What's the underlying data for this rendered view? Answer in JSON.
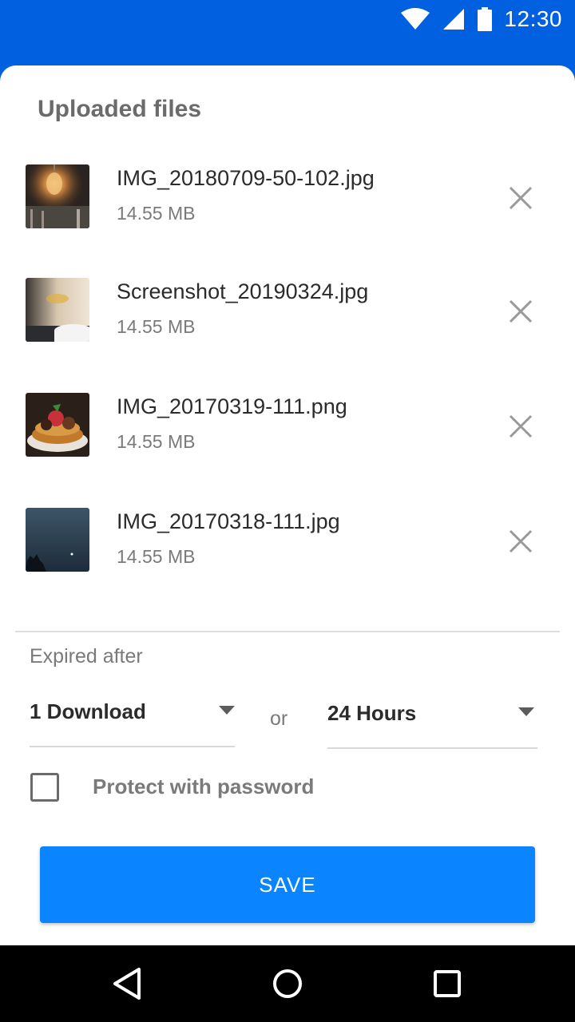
{
  "status_bar": {
    "time": "12:30",
    "icons": [
      "wifi-icon",
      "cell-signal-icon",
      "battery-icon"
    ]
  },
  "sheet": {
    "title": "Uploaded files",
    "files": [
      {
        "name": "IMG_20180709-50-102.jpg",
        "size": "14.55 MB",
        "thumb": "lightbulb-photo"
      },
      {
        "name": "Screenshot_20190324.jpg",
        "size": "14.55 MB",
        "thumb": "coffee-cup-photo"
      },
      {
        "name": "IMG_20170319-111.png",
        "size": "14.55 MB",
        "thumb": "pancakes-photo"
      },
      {
        "name": "IMG_20170318-111.jpg",
        "size": "14.55 MB",
        "thumb": "night-sky-photo"
      }
    ]
  },
  "expiry": {
    "label": "Expired after",
    "downloads_value": "1 Download",
    "or_text": "or",
    "time_value": "24 Hours"
  },
  "password": {
    "label": "Protect with password",
    "checked": false
  },
  "save_label": "SAVE",
  "colors": {
    "brand_blue": "#0060df",
    "button_blue": "#0a84ff"
  }
}
